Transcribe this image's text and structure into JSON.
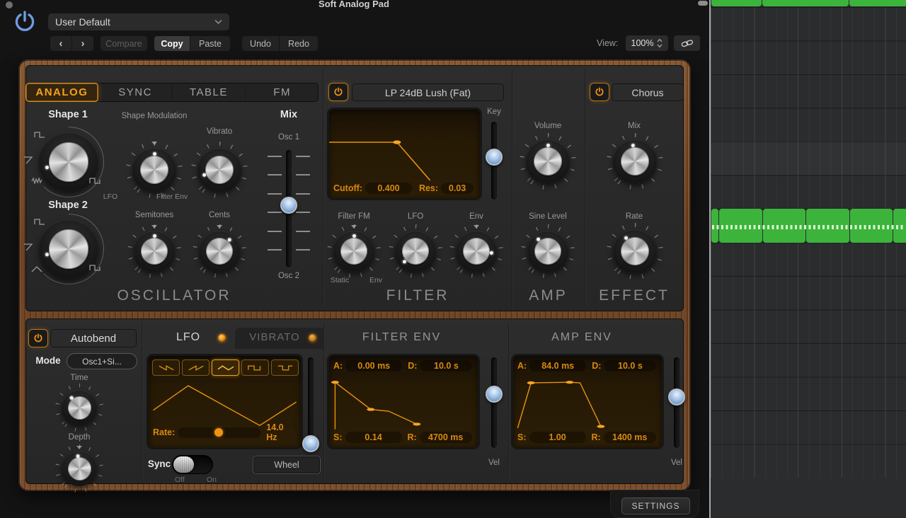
{
  "window": {
    "title": "Soft Analog Pad"
  },
  "header": {
    "preset": "User Default",
    "nav_back": "‹",
    "nav_fwd": "›",
    "compare": "Compare",
    "copy": "Copy",
    "paste": "Paste",
    "undo": "Undo",
    "redo": "Redo",
    "view_label": "View:",
    "view_value": "100%"
  },
  "tabs": [
    {
      "label": "ANALOG"
    },
    {
      "label": "SYNC"
    },
    {
      "label": "TABLE"
    },
    {
      "label": "FM"
    }
  ],
  "oscillator": {
    "title": "OSCILLATOR",
    "shape1_label": "Shape 1",
    "shape2_label": "Shape 2",
    "shape_mod_label": "Shape Modulation",
    "shape_mod_min": "LFO",
    "shape_mod_max": "Filter Env",
    "vibrato_label": "Vibrato",
    "semitones_label": "Semitones",
    "cents_label": "Cents",
    "mix_label": "Mix",
    "mix_top": "Osc 1",
    "mix_bottom": "Osc 2"
  },
  "filter": {
    "title": "FILTER",
    "preset": "LP 24dB Lush (Fat)",
    "cutoff_label": "Cutoff:",
    "cutoff_value": "0.400",
    "res_label": "Res:",
    "res_value": "0.03",
    "key_label": "Key",
    "filter_fm_label": "Filter FM",
    "fm_min": "Static",
    "fm_max": "Env",
    "lfo_label": "LFO",
    "env_label": "Env"
  },
  "amp": {
    "title": "AMP",
    "volume_label": "Volume",
    "sine_level_label": "Sine Level"
  },
  "effect": {
    "title": "EFFECT",
    "preset": "Chorus",
    "mix_label": "Mix",
    "rate_label": "Rate"
  },
  "autobend": {
    "label": "Autobend",
    "mode_label": "Mode",
    "mode_value": "Osc1+Si...",
    "time_label": "Time",
    "depth_label": "Depth"
  },
  "lfo": {
    "tab_lfo": "LFO",
    "tab_vibrato": "VIBRATO",
    "rate_label": "Rate:",
    "rate_value": "14.0 Hz",
    "sync_label": "Sync",
    "sync_off": "Off",
    "sync_on": "On",
    "wheel_label": "Wheel"
  },
  "filter_env": {
    "title": "FILTER ENV",
    "a_label": "A:",
    "a_value": "0.00 ms",
    "d_label": "D:",
    "d_value": "10.0 s",
    "s_label": "S:",
    "s_value": "0.14",
    "r_label": "R:",
    "r_value": "4700 ms",
    "vel_label": "Vel"
  },
  "amp_env": {
    "title": "AMP ENV",
    "a_label": "A:",
    "a_value": "84.0 ms",
    "d_label": "D:",
    "d_value": "10.0 s",
    "s_label": "S:",
    "s_value": "1.00",
    "r_label": "R:",
    "r_value": "1400 ms",
    "vel_label": "Vel"
  },
  "settings_label": "SETTINGS",
  "colors": {
    "accent_orange": "#f6a11c",
    "screen_orange": "#e8920a",
    "slider_blue": "#9cbfe8",
    "region_green": "#3cb43c",
    "power_blue": "#6f9ce0"
  }
}
